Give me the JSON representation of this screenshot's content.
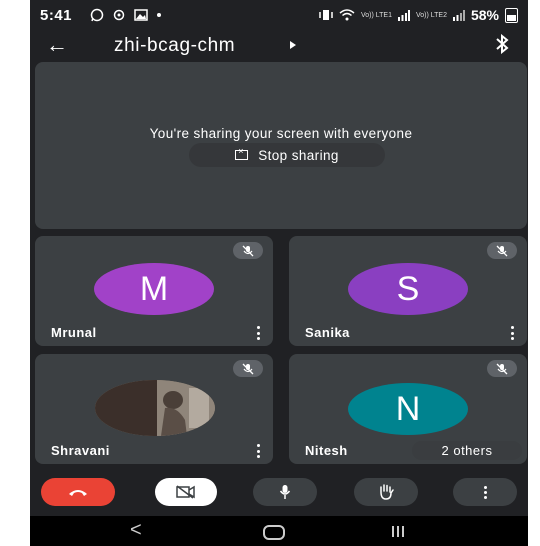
{
  "status_bar": {
    "time": "5:41",
    "net1": "Vo)) LTE1",
    "net2": "Vo)) LTE2",
    "battery": "58%"
  },
  "header": {
    "meeting_code": "zhi-bcag-chm"
  },
  "screen_share": {
    "message": "You're sharing your screen with everyone",
    "stop_label": "Stop sharing"
  },
  "participants": [
    {
      "name": "Mrunal",
      "initial": "M",
      "color": "#a142c8",
      "muted": true
    },
    {
      "name": "Sanika",
      "initial": "S",
      "color": "#8a3fc1",
      "muted": true
    },
    {
      "name": "Shravani",
      "initial": "",
      "muted": true
    },
    {
      "name": "Nitesh",
      "initial": "N",
      "color": "#00838f",
      "muted": true
    }
  ],
  "others_label": "2 others",
  "controls": {
    "end_call_color": "#ea4335",
    "icons": [
      "end-call-icon",
      "camera-off-icon",
      "microphone-icon",
      "raise-hand-icon",
      "more-options-icon"
    ]
  },
  "nav": {
    "back": "<"
  }
}
